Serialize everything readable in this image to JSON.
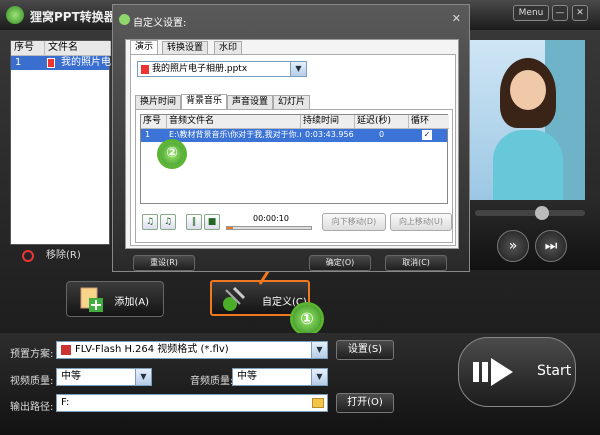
{
  "app": {
    "title": "狸窝PPT转换器",
    "menu_label": "Menu"
  },
  "list": {
    "headers": [
      "序号",
      "文件名"
    ],
    "rows": [
      {
        "index": "1",
        "name": "我的照片电"
      }
    ]
  },
  "remove_label": "移除(R)",
  "add_button": "添加(A)",
  "customize_button": "自定义(C)",
  "dialog": {
    "title": "自定义设置:",
    "close": "✕",
    "tabs": [
      "演示",
      "转换设置",
      "水印"
    ],
    "file_select": "我的照片电子相册.pptx",
    "subtabs": [
      "换片时间",
      "背景音乐",
      "声音设置",
      "幻灯片"
    ],
    "table_headers": [
      "序号",
      "音频文件名",
      "持续时间",
      "延迟(秒)",
      "循环"
    ],
    "table_rows": [
      {
        "index": "1",
        "file": "E:\\教材背景音乐\\你对于我,我对于你.r",
        "duration": "0:03:43.956",
        "delay": "0",
        "loop": "✓"
      }
    ],
    "time_readout": "00:00:10",
    "move_down": "向下移动(D)",
    "move_up": "向上移动(U)",
    "reset": "重设(R)",
    "ok": "确定(O)",
    "cancel": "取消(C)"
  },
  "badges": {
    "one": "①",
    "two": "②"
  },
  "settings": {
    "preset_label": "预置方案:",
    "preset_value": "FLV-Flash H.264 视频格式 (*.flv)",
    "settings_button": "设置(S)",
    "video_quality_label": "视频质量:",
    "video_quality": "中等",
    "audio_quality_label": "音频质量:",
    "audio_quality": "中等",
    "output_label": "输出路径:",
    "output_value": "F:",
    "open_button": "打开(O)"
  },
  "start_label": "Start",
  "colors": {
    "accent": "#f07820",
    "selection": "#3c73d6",
    "badge": "#4caf2a"
  }
}
